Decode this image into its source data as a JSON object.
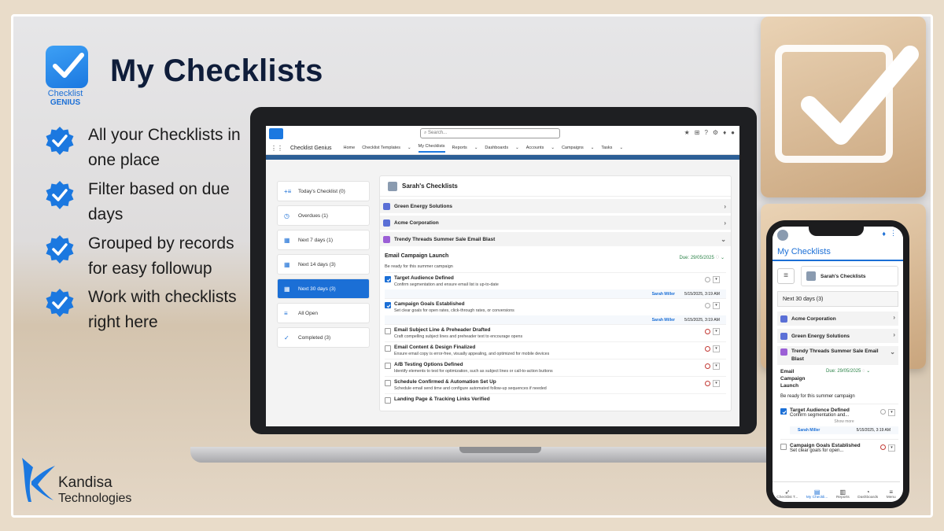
{
  "hero": {
    "logo_line1": "Checklist",
    "logo_line2": "GENIUS",
    "title": "My Checklists",
    "features": [
      "All your Checklists in one place",
      "Filter based on due days",
      "Grouped by records for easy followup",
      "Work with checklists right here"
    ],
    "company_line1": "Kandisa",
    "company_line2": "Technologies",
    "accent_color": "#1b78e0"
  },
  "desktop": {
    "search_placeholder": "Search...",
    "app_name": "Checklist Genius",
    "nav": [
      "Home",
      "Checklist Templates",
      "My Checklists",
      "Reports",
      "Dashboards",
      "Accounts",
      "Campaigns",
      "Tasks"
    ],
    "filters": [
      {
        "label": "Today's Checklist",
        "count": "(0)",
        "icon": "list-add-icon"
      },
      {
        "label": "Overdues",
        "count": "(1)",
        "icon": "clock-icon"
      },
      {
        "label": "Next 7 days",
        "count": "(1)",
        "icon": "calendar-icon"
      },
      {
        "label": "Next 14 days",
        "count": "(3)",
        "icon": "calendar-icon"
      },
      {
        "label": "Next 30 days",
        "count": "(3)",
        "icon": "calendar-icon"
      },
      {
        "label": "All Open",
        "count": "",
        "icon": "list-icon"
      },
      {
        "label": "Completed",
        "count": "(3)",
        "icon": "check-icon"
      }
    ],
    "panel_title": "Sarah's Checklists",
    "groups": [
      "Green Energy Solutions",
      "Acme Corporation",
      "Trendy Threads Summer Sale Email Blast"
    ],
    "campaign": {
      "title": "Email Campaign Launch",
      "due": "Due: 29/05/2025",
      "description": "Be ready for this summer campaign"
    },
    "tasks": [
      {
        "name": "Target Audience Defined",
        "desc": "Confirm segmentation and ensure email list is up-to-date",
        "done": true,
        "who": "Sarah Miller",
        "when": "5/15/2025, 3:19 AM"
      },
      {
        "name": "Campaign Goals Established",
        "desc": "Set clear goals for open rates, click-through rates, or conversions",
        "done": true,
        "who": "Sarah Miller",
        "when": "5/15/2025, 3:19 AM"
      },
      {
        "name": "Email Subject Line & Preheader Drafted",
        "desc": "Craft compelling subject lines and preheader text to encourage opens",
        "done": false
      },
      {
        "name": "Email Content & Design Finalized",
        "desc": "Ensure email copy is error-free, visually appealing, and optimized for mobile devices",
        "done": false
      },
      {
        "name": "A/B Testing Options Defined",
        "desc": "Identify elements to test for optimization, such as subject lines or call-to-action buttons",
        "done": false
      },
      {
        "name": "Schedule Confirmed & Automation Set Up",
        "desc": "Schedule email send time and configure automated follow-up sequences if needed",
        "done": false
      },
      {
        "name": "Landing Page & Tracking Links Verified",
        "desc": "",
        "done": false
      }
    ]
  },
  "mobile": {
    "title": "My Checklists",
    "panel_title": "Sarah's Checklists",
    "filter": "Next 30 days (3)",
    "groups": [
      "Acme Corporation",
      "Green Energy Solutions",
      "Trendy Threads Summer Sale Email Blast"
    ],
    "campaign_title": "Email Campaign Launch",
    "due": "Due: 29/05/2025",
    "description": "Be ready for this summer campaign",
    "task1_name": "Target Audience Defined",
    "task1_desc": "Confirm segmentation and...",
    "show_more": "Show more",
    "task1_who": "Sarah Miller",
    "task1_when": "5/15/2025, 3:19 AM",
    "task2_name": "Campaign Goals Established",
    "task2_desc": "Set clear goals for open...",
    "tabs": [
      "Checklist T...",
      "My Checkli...",
      "Reports",
      "Dashboards",
      "Menu"
    ]
  }
}
